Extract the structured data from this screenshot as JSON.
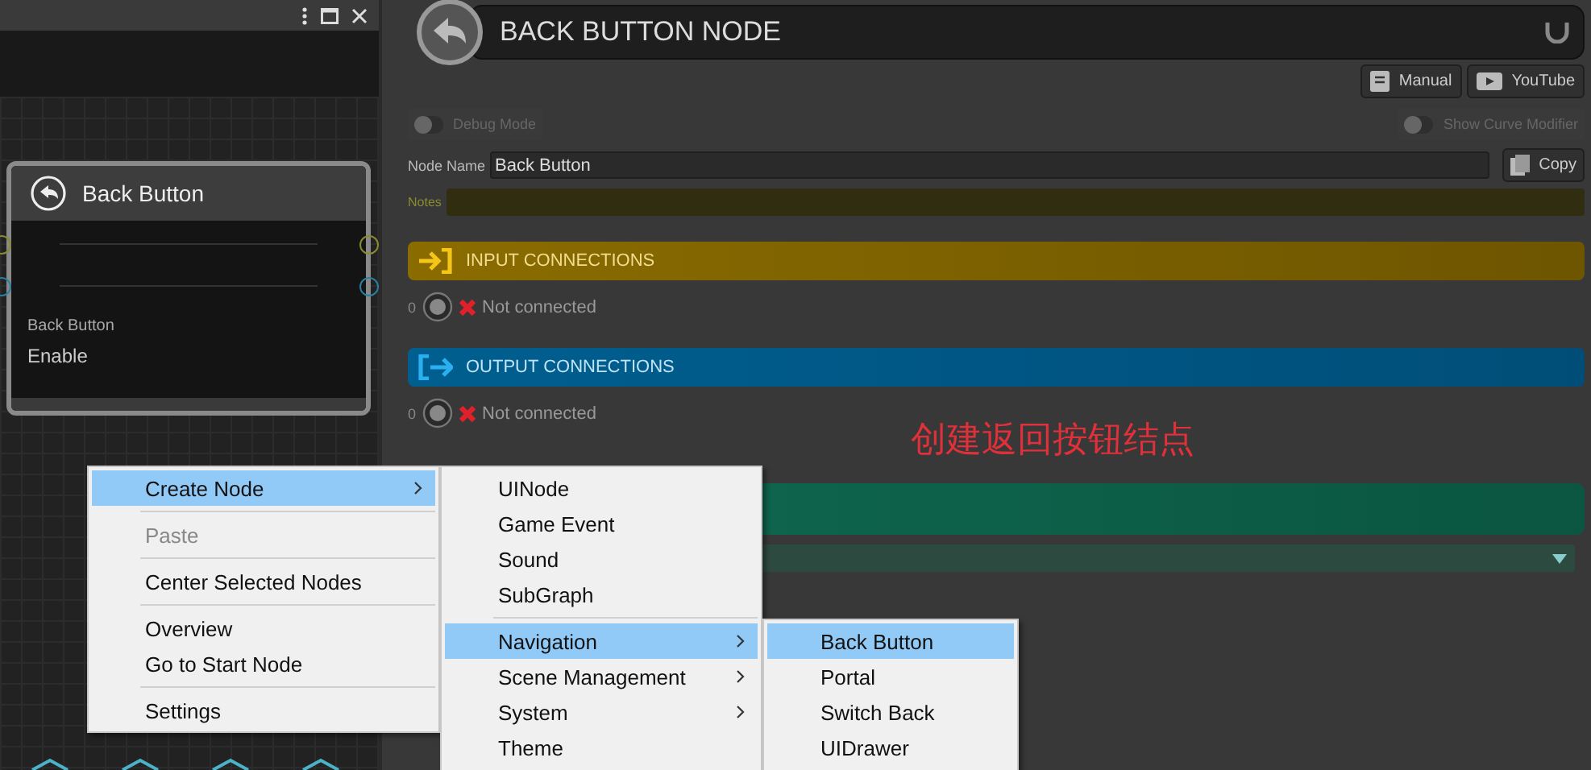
{
  "graph_panel": {
    "node": {
      "title": "Back Button",
      "field_label": "Back Button",
      "field_value": "Enable"
    }
  },
  "inspector": {
    "title": "BACK BUTTON NODE",
    "links": [
      {
        "kind": "manual",
        "label": "Manual"
      },
      {
        "kind": "youtube",
        "label": "YouTube"
      }
    ],
    "toggles": [
      {
        "label": "Debug Mode",
        "on": false
      },
      {
        "label": "Show Curve Modifier",
        "on": false
      }
    ],
    "node_name": {
      "label": "Node Name",
      "value": "Back Button"
    },
    "copy_button": "Copy",
    "notes": {
      "label": "Notes"
    },
    "sections": [
      {
        "kind": "input",
        "title": "INPUT CONNECTIONS",
        "index": "0",
        "status": "Not connected"
      },
      {
        "kind": "output",
        "title": "OUTPUT CONNECTIONS",
        "index": "0",
        "status": "Not connected"
      }
    ],
    "annotation": "创建返回按钮结点"
  },
  "context_menu": {
    "items": [
      {
        "label": "Create Node",
        "selected": true,
        "disabled": false,
        "submenu": true,
        "separator_after": true
      },
      {
        "label": "Paste",
        "selected": false,
        "disabled": true,
        "submenu": false,
        "separator_after": true
      },
      {
        "label": "Center Selected Nodes",
        "selected": false,
        "disabled": false,
        "submenu": false,
        "separator_after": true
      },
      {
        "label": "Overview",
        "selected": false,
        "disabled": false,
        "submenu": false,
        "separator_after": false
      },
      {
        "label": "Go to Start Node",
        "selected": false,
        "disabled": false,
        "submenu": false,
        "separator_after": true
      },
      {
        "label": "Settings",
        "selected": false,
        "disabled": false,
        "submenu": false,
        "separator_after": false
      }
    ]
  },
  "create_node_menu": {
    "items": [
      {
        "label": "UINode",
        "selected": false,
        "submenu": false,
        "separator_after": false
      },
      {
        "label": "Game Event",
        "selected": false,
        "submenu": false,
        "separator_after": false
      },
      {
        "label": "Sound",
        "selected": false,
        "submenu": false,
        "separator_after": false
      },
      {
        "label": "SubGraph",
        "selected": false,
        "submenu": false,
        "separator_after": true
      },
      {
        "label": "Navigation",
        "selected": true,
        "submenu": true,
        "separator_after": false
      },
      {
        "label": "Scene Management",
        "selected": false,
        "submenu": true,
        "separator_after": false
      },
      {
        "label": "System",
        "selected": false,
        "submenu": true,
        "separator_after": false
      },
      {
        "label": "Theme",
        "selected": false,
        "submenu": false,
        "separator_after": false
      }
    ]
  },
  "navigation_menu": {
    "items": [
      {
        "label": "Back Button",
        "selected": true
      },
      {
        "label": "Portal",
        "selected": false
      },
      {
        "label": "Switch Back",
        "selected": false
      },
      {
        "label": "UIDrawer",
        "selected": false
      }
    ]
  }
}
